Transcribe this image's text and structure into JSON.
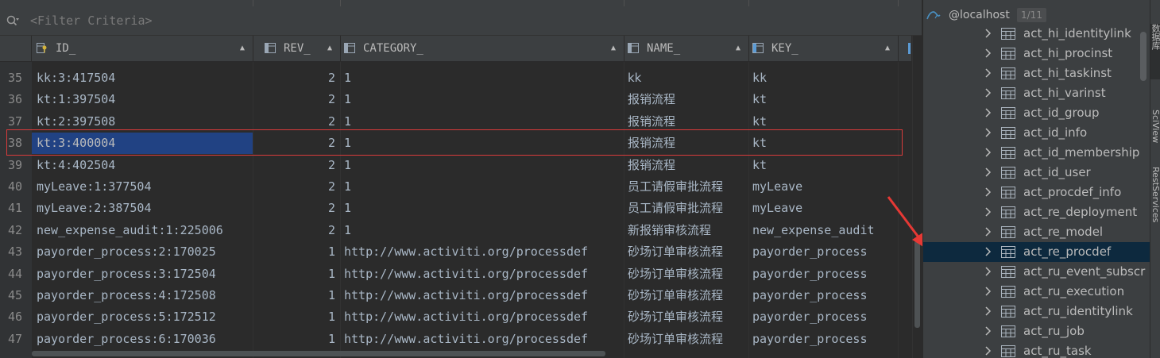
{
  "filter": {
    "placeholder": "<Filter Criteria>"
  },
  "columns": [
    {
      "label": "ID_",
      "icon": "key-column-icon"
    },
    {
      "label": "REV_",
      "icon": "column-icon"
    },
    {
      "label": "CATEGORY_",
      "icon": "column-icon"
    },
    {
      "label": "NAME_",
      "icon": "column-icon"
    },
    {
      "label": "KEY_",
      "icon": "column-icon"
    }
  ],
  "rows": [
    {
      "num": "35",
      "id": "kk:3:417504",
      "rev": "2",
      "category": "1",
      "name": "kk",
      "key": "kk"
    },
    {
      "num": "36",
      "id": "kt:1:397504",
      "rev": "2",
      "category": "1",
      "name": "报销流程",
      "key": "kt"
    },
    {
      "num": "37",
      "id": "kt:2:397508",
      "rev": "2",
      "category": "1",
      "name": "报销流程",
      "key": "kt"
    },
    {
      "num": "38",
      "id": "kt:3:400004",
      "rev": "2",
      "category": "1",
      "name": "报销流程",
      "key": "kt"
    },
    {
      "num": "39",
      "id": "kt:4:402504",
      "rev": "2",
      "category": "1",
      "name": "报销流程",
      "key": "kt"
    },
    {
      "num": "40",
      "id": "myLeave:1:377504",
      "rev": "2",
      "category": "1",
      "name": "员工请假审批流程",
      "key": "myLeave"
    },
    {
      "num": "41",
      "id": "myLeave:2:387504",
      "rev": "2",
      "category": "1",
      "name": "员工请假审批流程",
      "key": "myLeave"
    },
    {
      "num": "42",
      "id": "new_expense_audit:1:225006",
      "rev": "2",
      "category": "1",
      "name": "新报销审核流程",
      "key": "new_expense_audit"
    },
    {
      "num": "43",
      "id": "payorder_process:2:170025",
      "rev": "1",
      "category": "http://www.activiti.org/processdef",
      "name": "砂场订单审核流程",
      "key": "payorder_process"
    },
    {
      "num": "44",
      "id": "payorder_process:3:172504",
      "rev": "1",
      "category": "http://www.activiti.org/processdef",
      "name": "砂场订单审核流程",
      "key": "payorder_process"
    },
    {
      "num": "45",
      "id": "payorder_process:4:172508",
      "rev": "1",
      "category": "http://www.activiti.org/processdef",
      "name": "砂场订单审核流程",
      "key": "payorder_process"
    },
    {
      "num": "46",
      "id": "payorder_process:5:172512",
      "rev": "1",
      "category": "http://www.activiti.org/processdef",
      "name": "砂场订单审核流程",
      "key": "payorder_process"
    },
    {
      "num": "47",
      "id": "payorder_process:6:170036",
      "rev": "1",
      "category": "http://www.activiti.org/processdef",
      "name": "砂场订单审核流程",
      "key": "payorder_process"
    }
  ],
  "database_panel": {
    "connection": "@localhost",
    "count": "1/11",
    "tables": [
      "act_hi_identitylink",
      "act_hi_procinst",
      "act_hi_taskinst",
      "act_hi_varinst",
      "act_id_group",
      "act_id_info",
      "act_id_membership",
      "act_id_user",
      "act_procdef_info",
      "act_re_deployment",
      "act_re_model",
      "act_re_procdef",
      "act_ru_event_subscr",
      "act_ru_execution",
      "act_ru_identitylink",
      "act_ru_job",
      "act_ru_task"
    ],
    "selected_table": "act_re_procdef"
  },
  "side_tabs": {
    "database": "数据库",
    "sciview": "SciView",
    "rest": "RestServices"
  },
  "colors": {
    "selection": "#214283",
    "highlight_box": "#d93b3b",
    "arrow": "#e53935",
    "tree_selected": "#0d293e"
  }
}
